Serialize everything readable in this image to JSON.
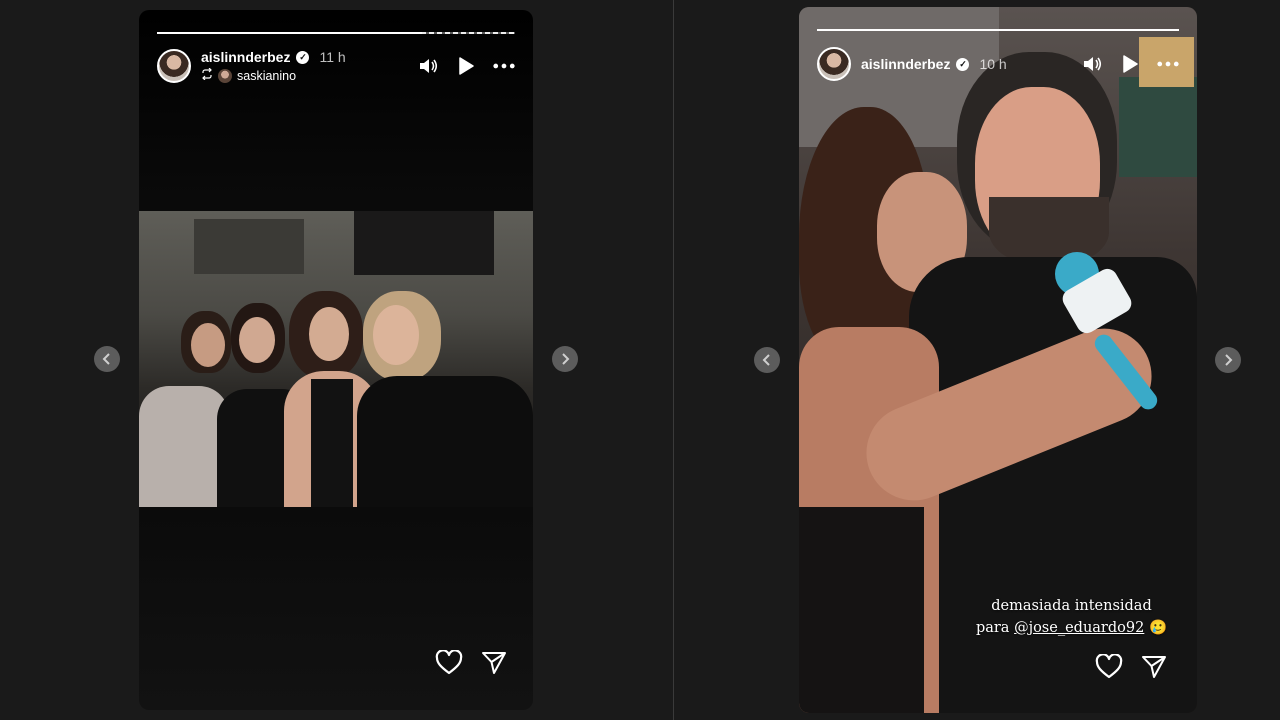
{
  "stories": [
    {
      "username": "aislinnderbez",
      "time": "11 h",
      "reshared_from": "saskianino",
      "progress_fill": 0.74,
      "icons": [
        "mute-icon",
        "play-icon",
        "more-icon",
        "heart-icon",
        "share-icon"
      ]
    },
    {
      "username": "aislinnderbez",
      "time": "10 h",
      "progress_fill": 1.0,
      "caption_line1": "demasiada intensidad",
      "caption_prefix": "para",
      "caption_mention": "@jose_eduardo92",
      "caption_emoji": "🥲",
      "icons": [
        "mute-icon",
        "play-icon",
        "more-icon",
        "heart-icon",
        "share-icon"
      ]
    }
  ],
  "colors": {
    "background": "#1a1a1a",
    "nav_button": "#5c5c5c",
    "mic_blue": "#3aaac8"
  }
}
